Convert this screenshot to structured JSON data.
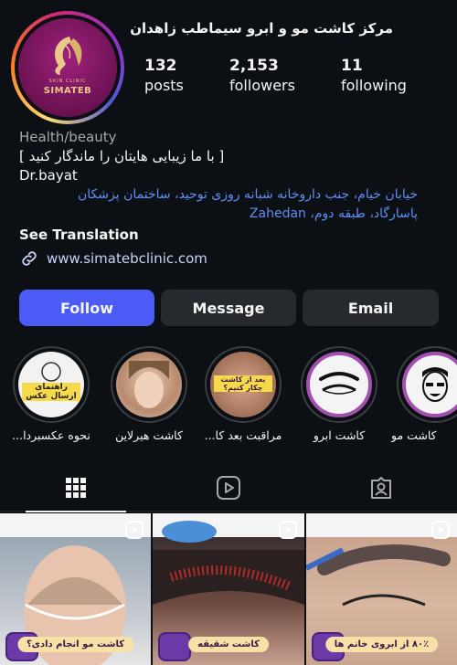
{
  "profile": {
    "name": "مرکز کاشت مو و ابرو سیماطب زاهدان",
    "logo_subtitle": "SKIN CLINIC",
    "logo_text": "SIMATEB",
    "stats": [
      {
        "value": "132",
        "label": "posts"
      },
      {
        "value": "2,153",
        "label": "followers"
      },
      {
        "value": "11",
        "label": "following"
      }
    ]
  },
  "bio": {
    "category": "Health/beauty",
    "tagline": "[ با ما زیبایی هایتان را ماندگار کنید ]",
    "doctor": "Dr.bayat",
    "address_line1": "خیابان خیام، جنب داروخانه شبانه روزی توحید، ساختمان پزشکان",
    "address_line2": "پاسارگاد، طبقه دوم، Zahedan",
    "see_translation": "See Translation",
    "website": "www.simatebclinic.com"
  },
  "buttons": {
    "follow": "Follow",
    "message": "Message",
    "email": "Email"
  },
  "highlights": [
    {
      "label": "نحوه عکسبردا...",
      "image_text": "راهنمای ارسال عکس"
    },
    {
      "label": "کاشت هیرلاین"
    },
    {
      "label": "مراقبت بعد کا...",
      "image_text": "بعد از کاشت چکار کنیم؟"
    },
    {
      "label": "کاشت ابرو"
    },
    {
      "label": "کاشت مو"
    }
  ],
  "tabs": [
    {
      "name": "grid-icon"
    },
    {
      "name": "reels-icon"
    },
    {
      "name": "tagged-icon"
    }
  ],
  "posts": [
    {
      "caption": "کاشت مو انجام دادی؟"
    },
    {
      "caption": "کاشت شقیقه"
    },
    {
      "caption": "۸۰٪ از ابروی خانم ها"
    }
  ],
  "colors": {
    "background": "#0c1014",
    "follow_button": "#4a5cf5",
    "secondary_button": "#26292e",
    "link": "#5d8ff5",
    "muted": "#a8a8a8"
  }
}
